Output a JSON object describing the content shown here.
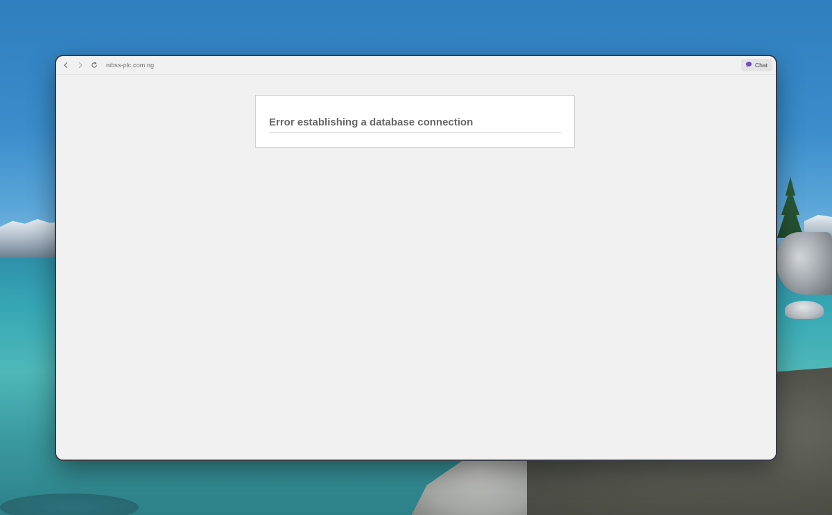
{
  "browser": {
    "url": "nibss-plc.com.ng",
    "chat_label": "Chat",
    "icons": {
      "back": "chevron-left-icon",
      "forward": "chevron-right-icon",
      "reload": "reload-icon",
      "chat": "chat-bubble-icon"
    },
    "chat_icon_color": "#6b4fbb"
  },
  "page": {
    "error_title": "Error establishing a database connection"
  }
}
